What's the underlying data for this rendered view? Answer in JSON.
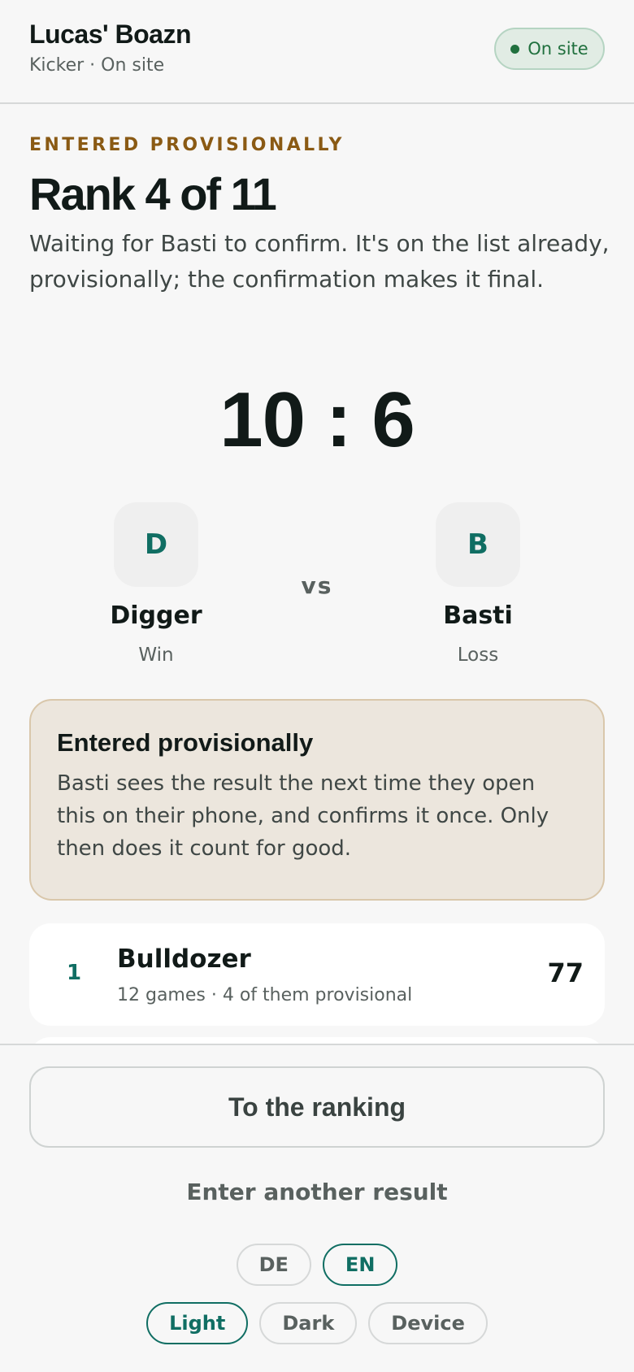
{
  "header": {
    "title": "Lucas' Boazn",
    "subtitle": "Kicker · On site",
    "status_label": "On site"
  },
  "result": {
    "eyebrow": "ENTERED PROVISIONALLY",
    "rank_title": "Rank 4 of 11",
    "intro": "Waiting for Basti to confirm. It's on the list already, provisionally; the confirmation makes it final.",
    "score": "10 : 6",
    "vs": "vs",
    "players": [
      {
        "initial": "D",
        "name": "Digger",
        "result": "Win"
      },
      {
        "initial": "B",
        "name": "Basti",
        "result": "Loss"
      }
    ]
  },
  "notice": {
    "title": "Entered provisionally",
    "body": "Basti sees the result the next time they open this on their phone, and confirms it once. Only then does it count for good."
  },
  "ranking_preview": [
    {
      "position": "1",
      "name": "Bulldozer",
      "meta": "12 games · 4 of them provisional",
      "points": "77"
    }
  ],
  "footer": {
    "primary_button": "To the ranking",
    "secondary_link": "Enter another result",
    "languages": [
      "DE",
      "EN"
    ],
    "active_language": "EN",
    "themes": [
      "Light",
      "Dark",
      "Device"
    ],
    "active_theme": "Light"
  },
  "colors": {
    "accent": "#106e63",
    "provisional": "#8a5a14",
    "status_green": "#20703e"
  }
}
